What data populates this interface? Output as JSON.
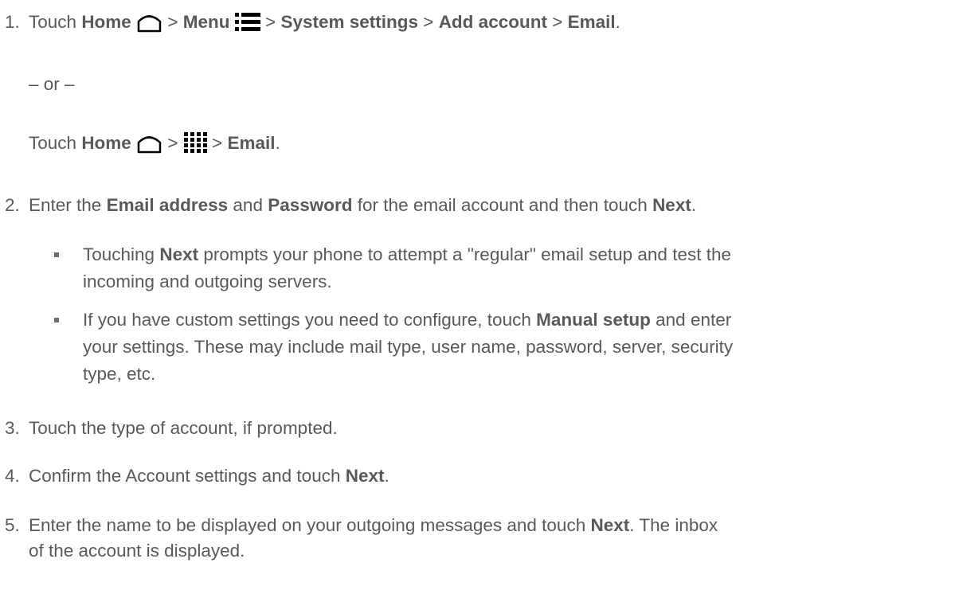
{
  "steps": {
    "s1": {
      "num": "1.",
      "touch": "Touch",
      "home": "Home",
      "gt": ">",
      "menu": "Menu",
      "system_settings": "System settings",
      "add_account": "Add account",
      "email": "Email",
      "end": "."
    },
    "or": "– or –",
    "s1b": {
      "touch": "Touch",
      "home": "Home",
      "gt": ">",
      "email": "Email",
      "end": "."
    },
    "s2": {
      "num": "2.",
      "a": "Enter the",
      "email_address": "Email address",
      "and": "and",
      "password": "Password",
      "b": "for the email account and then touch",
      "next": "Next",
      "end": "."
    },
    "b1": {
      "a": "Touching",
      "next": "Next",
      "b": "prompts your phone to attempt a \"regular\" email setup and test the",
      "c": "incoming and outgoing servers."
    },
    "b2": {
      "a": "If you have custom settings you need to configure, touch",
      "manual": "Manual setup",
      "b": "and enter",
      "c": "your settings. These may include mail type, user name, password, server, security",
      "d": "type, etc."
    },
    "s3": {
      "num": "3.",
      "text": "Touch the type of account, if prompted."
    },
    "s4": {
      "num": "4.",
      "a": "Confirm the Account settings and touch",
      "next": "Next",
      "end": "."
    },
    "s5": {
      "num": "5.",
      "a": "Enter the name to be displayed on your outgoing messages and touch",
      "next": "Next",
      "b": ". The inbox",
      "c": "of the account is displayed."
    }
  },
  "icons": {
    "home": "home-icon",
    "menu": "menu-icon",
    "apps": "apps-grid-icon"
  }
}
